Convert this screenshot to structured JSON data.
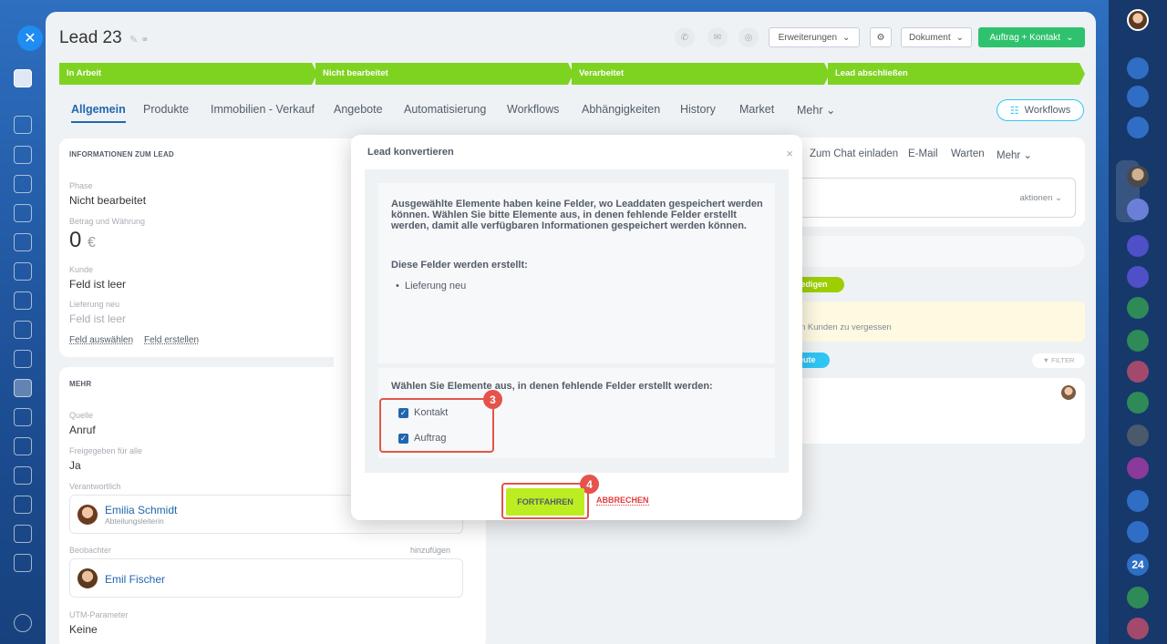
{
  "header": {
    "title": "Lead 23",
    "erweiterungen_label": "Erweiterungen",
    "dokument_label": "Dokument",
    "auftrag_kontakt_label": "Auftrag + Kontakt"
  },
  "stages": [
    {
      "label": "In Arbeit"
    },
    {
      "label": "Nicht bearbeitet"
    },
    {
      "label": "Verarbeitet"
    },
    {
      "label": "Lead abschließen"
    }
  ],
  "tabs": [
    {
      "label": "Allgemein"
    },
    {
      "label": "Produkte"
    },
    {
      "label": "Immobilien - Verkauf"
    },
    {
      "label": "Angebote"
    },
    {
      "label": "Automatisierung"
    },
    {
      "label": "Workflows"
    },
    {
      "label": "Abhängigkeiten"
    },
    {
      "label": "History"
    },
    {
      "label": "Market"
    },
    {
      "label": "Mehr"
    }
  ],
  "workflows_button": "Workflows",
  "info_card": {
    "section_title": "INFORMATIONEN ZUM LEAD",
    "phase_label": "Phase",
    "phase_value": "Nicht bearbeitet",
    "amount_label": "Betrag und Währung",
    "amount_value": "0",
    "currency": "€",
    "client_label": "Kunde",
    "client_value": "Feld ist leer",
    "delivery_label": "Lieferung neu",
    "delivery_value": "Feld ist leer",
    "select_field_link": "Feld auswählen",
    "create_field_link": "Feld erstellen"
  },
  "more_card": {
    "section_title": "MEHR",
    "source_label": "Quelle",
    "source_value": "Anruf",
    "shared_label": "Freigegeben für alle",
    "shared_value": "Ja",
    "responsible_label": "Verantwortlich",
    "responsible_name": "Emilia Schmidt",
    "responsible_role": "Abteilungsleiterin",
    "observer_label": "Beobachter",
    "observer_add": "hinzufügen",
    "observer_name": "Emil Fischer",
    "utm_label": "UTM-Parameter",
    "utm_value": "Keine"
  },
  "activity": {
    "invite_chat": "Zum Chat einladen",
    "email": "E-Mail",
    "wait": "Warten",
    "more": "Mehr",
    "actions": "aktionen",
    "done_badge": "ledigen",
    "reminder_text": "n Kunden zu vergessen",
    "today_badge": "eute",
    "filter": "FILTER"
  },
  "modal": {
    "title": "Lead konvertieren",
    "info_text": "Ausgewählte Elemente haben keine Felder, wo Leaddaten gespeichert werden können. Wählen Sie bitte Elemente aus, in denen fehlende Felder erstellt werden, damit alle verfügbaren Informationen gespeichert werden können.",
    "fields_heading": "Diese Felder werden erstellt:",
    "fields": [
      "Lieferung neu"
    ],
    "select_heading": "Wählen Sie Elemente aus, in denen fehlende Felder erstellt werden:",
    "options": [
      {
        "label": "Kontakt",
        "checked": true
      },
      {
        "label": "Auftrag",
        "checked": true
      }
    ],
    "continue_button": "FORTFAHREN",
    "cancel_button": "ABBRECHEN",
    "step_3": "3",
    "step_4": "4"
  },
  "right_sidebar": {
    "badge_24": "24"
  },
  "colors": {
    "stage_green": "#7ed321",
    "continue_bg": "#bbed21",
    "highlight_red": "#e5534b",
    "link_blue": "#2067b0"
  }
}
